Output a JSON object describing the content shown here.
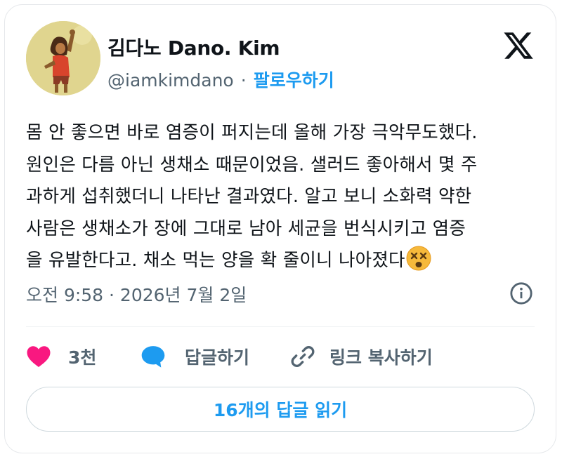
{
  "author": {
    "name": "김다노 Dano. Kim",
    "handle": "@iamkimdano",
    "separator": "·",
    "follow_label": "팔로우하기"
  },
  "tweet": {
    "lines": [
      "몸 안 좋으면 바로 염증이 퍼지는데 올해 가장 극악무도했다.",
      "원인은 다름 아닌 생채소 때문이었음. 샐러드 좋아해서 몇 주",
      "과하게 섭취했더니 나타난 결과였다. 알고 보니 소화력 약한",
      "사람은 생채소가 장에 그대로 남아 세균을 번식시키고 염증",
      "을 유발한다고. 채소 먹는 양을 확 줄이니 나아졌다"
    ],
    "emoji": "dizzy-face"
  },
  "meta": {
    "timestamp": "오전 9:58 · 2026년 7월 2일"
  },
  "actions": {
    "like_count": "3천",
    "reply_label": "답글하기",
    "copy_link_label": "링크 복사하기"
  },
  "read_replies_label": "16개의 답글 읽기",
  "colors": {
    "accent": "#1d9bf0",
    "like": "#f91880",
    "text": "#0f1419",
    "muted": "#536471"
  },
  "icons": [
    "x-logo",
    "info-icon",
    "heart-icon",
    "speech-bubble-icon",
    "link-icon",
    "dizzy-face-emoji"
  ]
}
